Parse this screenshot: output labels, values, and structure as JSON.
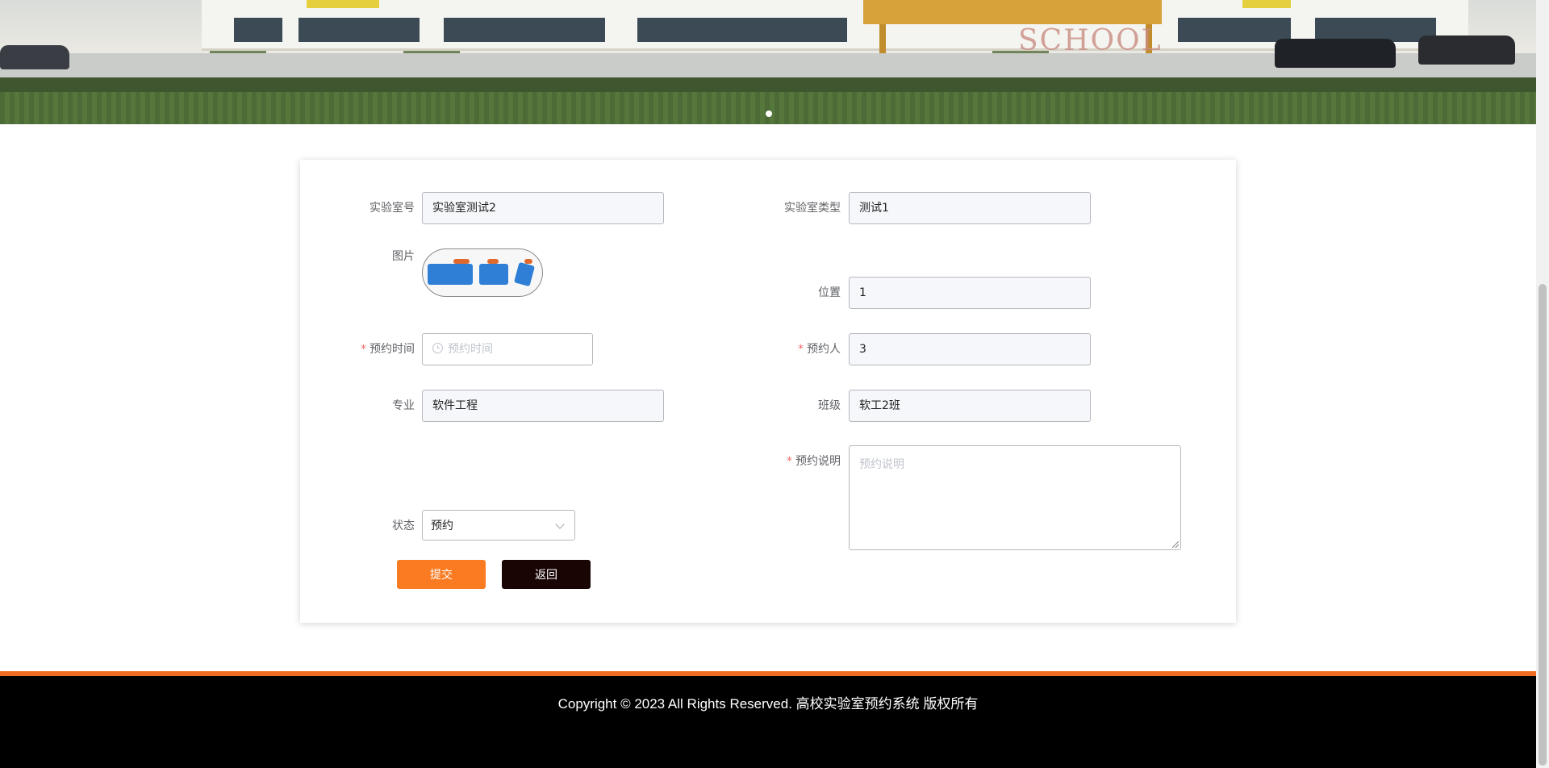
{
  "banner": {
    "active_slide": 1,
    "slide_count": 1,
    "sign_text": "SCHOOL"
  },
  "form": {
    "lab_no": {
      "label": "实验室号",
      "value": "实验室测试2"
    },
    "lab_type": {
      "label": "实验室类型",
      "value": "测试1"
    },
    "image": {
      "label": "图片"
    },
    "location": {
      "label": "位置",
      "value": "1"
    },
    "reserve_time": {
      "label": "预约时间",
      "placeholder": "预约时间",
      "required": true
    },
    "reserver": {
      "label": "预约人",
      "value": "3",
      "required": true
    },
    "major": {
      "label": "专业",
      "value": "软件工程"
    },
    "class": {
      "label": "班级",
      "value": "软工2班"
    },
    "description": {
      "label": "预约说明",
      "placeholder": "预约说明",
      "required": true
    },
    "status": {
      "label": "状态",
      "value": "预约"
    },
    "required_mark": "*",
    "submit_label": "提交",
    "back_label": "返回"
  },
  "footer": {
    "copyright": "Copyright © 2023 All Rights Reserved. 高校实验室预约系统 版权所有"
  },
  "colors": {
    "accent": "#fa7b22",
    "footer_line": "#ef6c23",
    "back_button": "#1a0505",
    "required": "#f56c6c"
  }
}
